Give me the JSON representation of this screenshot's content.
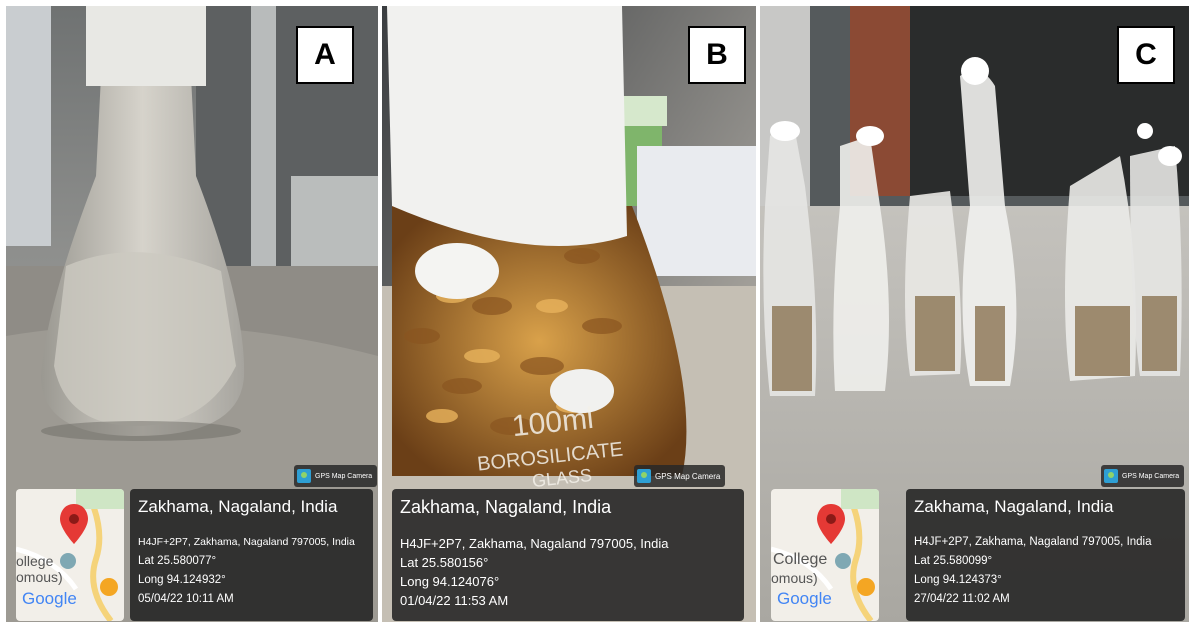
{
  "panels": [
    {
      "letter": "A",
      "gps_badge": "GPS Map Camera",
      "location": "Zakhama, Nagaland, India",
      "address": "H4JF+2P7, Zakhama, Nagaland 797005, India",
      "lat": "Lat 25.580077°",
      "long": "Long 94.124932°",
      "datetime": "05/04/22 10:11 AM",
      "map_label": "ollege\nomous)",
      "map_brand": "Google",
      "icon": "location-pin-icon"
    },
    {
      "letter": "B",
      "gps_badge": "GPS Map Camera",
      "location": "Zakhama, Nagaland, India",
      "address": "H4JF+2P7, Zakhama, Nagaland 797005, India",
      "lat": "Lat 25.580156°",
      "long": "Long 94.124076°",
      "datetime": "01/04/22 11:53 AM",
      "flask_text_1": "100ml",
      "flask_text_2": "BOROSILICATE",
      "flask_text_3": "GLASS"
    },
    {
      "letter": "C",
      "gps_badge": "GPS Map Camera",
      "location": "Zakhama, Nagaland, India",
      "address": "H4JF+2P7, Zakhama, Nagaland 797005, India",
      "lat": "Lat 25.580099°",
      "long": "Long 94.124373°",
      "datetime": "27/04/22 11:02 AM",
      "map_label_1": "College",
      "map_label_2": "omous)",
      "map_brand": "Google"
    }
  ],
  "colors": {
    "overlay": "#202020",
    "google_blue": "#4285F4",
    "google_red": "#EA4335",
    "google_yellow": "#FBBC05",
    "google_green": "#34A853",
    "pin_red": "#e53935"
  }
}
